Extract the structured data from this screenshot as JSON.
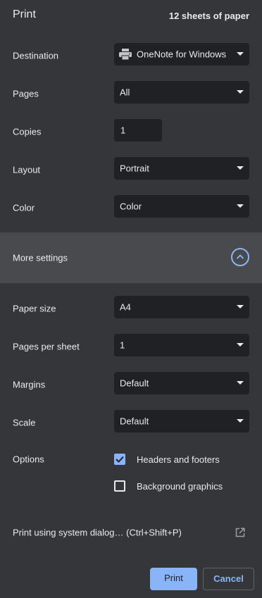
{
  "header": {
    "title": "Print",
    "sheets": "12 sheets of paper"
  },
  "destination": {
    "label": "Destination",
    "value": "OneNote for Windows",
    "icon": "printer-icon"
  },
  "pages": {
    "label": "Pages",
    "value": "All"
  },
  "copies": {
    "label": "Copies",
    "value": "1"
  },
  "layout": {
    "label": "Layout",
    "value": "Portrait"
  },
  "color": {
    "label": "Color",
    "value": "Color"
  },
  "more_settings": {
    "label": "More settings",
    "icon": "chevron-up-icon",
    "expanded": true
  },
  "paper_size": {
    "label": "Paper size",
    "value": "A4"
  },
  "pages_per_sheet": {
    "label": "Pages per sheet",
    "value": "1"
  },
  "margins": {
    "label": "Margins",
    "value": "Default"
  },
  "scale": {
    "label": "Scale",
    "value": "Default"
  },
  "options": {
    "label": "Options",
    "items": [
      {
        "label": "Headers and footers",
        "checked": true
      },
      {
        "label": "Background graphics",
        "checked": false
      }
    ]
  },
  "system_dialog": {
    "label": "Print using system dialog… (Ctrl+Shift+P)",
    "icon": "open-in-new-icon"
  },
  "buttons": {
    "print": "Print",
    "cancel": "Cancel"
  },
  "colors": {
    "background": "#35363a",
    "field": "#202124",
    "accent": "#8ab4f8",
    "more_settings_bg": "#494a4e"
  }
}
